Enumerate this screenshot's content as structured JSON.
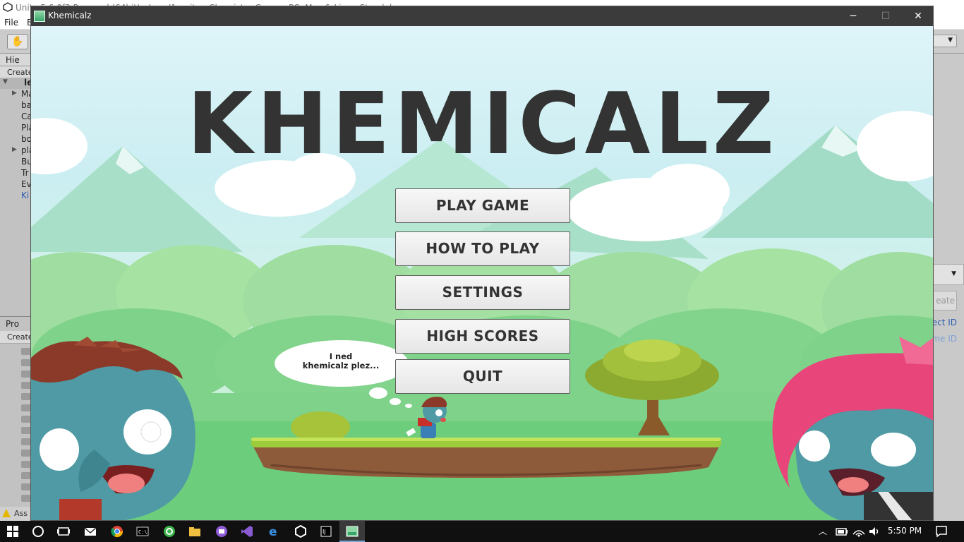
{
  "unity": {
    "title": "Unity 5.6.0f3 Personal (64bit) - Level1.unity - Chemistry Game - PC, Mac & Linux Standalone <DX11>",
    "menu": [
      "File",
      "E"
    ],
    "hierarchy_tab": "Hie",
    "create_label": "Create",
    "scene_label": "le",
    "hierarchy_items": [
      "Ma",
      "ba",
      "Ca",
      "Pla",
      "bo",
      "pla",
      "Bu",
      "Tr",
      "Ev",
      "Ki"
    ],
    "project_tab": "Pro",
    "console_text": "Ass",
    "inspector_create": "eate",
    "inspector_object_id": "ect ID",
    "inspector_name_id": "me ID"
  },
  "game_window": {
    "title": "Khemicalz",
    "minimize_icon": "minimize-icon",
    "maximize_icon": "maximize-icon",
    "close_icon": "close-icon"
  },
  "game": {
    "title": "KHEMICALZ",
    "buttons": {
      "play": "PLAY GAME",
      "how_to_play": "HOW TO PLAY",
      "settings": "SETTINGS",
      "high_scores": "HIGH SCORES",
      "quit": "QUIT"
    },
    "speech_line1": "I ned",
    "speech_line2": "khemicalz plez..."
  },
  "taskbar": {
    "clock": "5:50 PM",
    "icons": [
      "windows-start-icon",
      "search-icon",
      "task-view-icon",
      "mail-icon",
      "chrome-icon",
      "terminal-icon",
      "app-icon",
      "file-explorer-icon",
      "app-icon",
      "visual-studio-icon",
      "edge-icon",
      "unity-icon",
      "intellij-icon",
      "khemicalz-icon"
    ]
  },
  "colors": {
    "title_text": "#333333",
    "sky": "#cbeef2",
    "grass": "#8cc63f",
    "zombie_skin": "#4f9aa4",
    "pink_hair": "#e8457a"
  }
}
